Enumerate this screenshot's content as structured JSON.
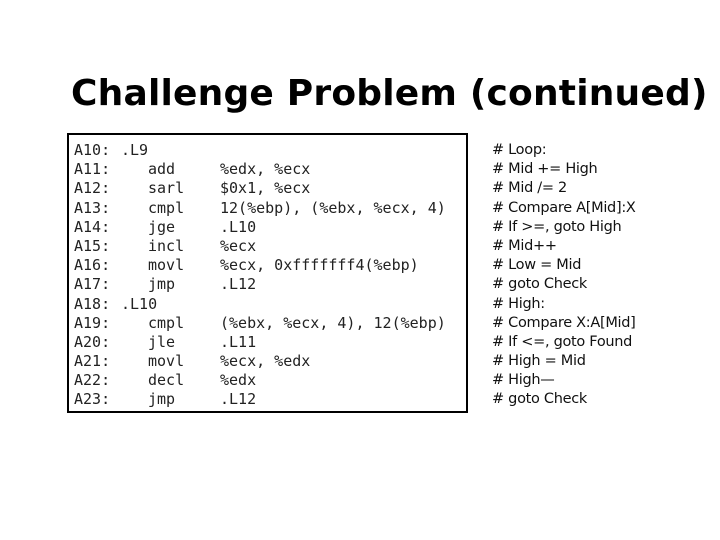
{
  "slide": {
    "title": "Challenge Problem (continued)"
  },
  "code": {
    "lines": [
      {
        "addr": "A10:",
        "label": ".L9",
        "op": "",
        "args": ""
      },
      {
        "addr": "A11:",
        "label": "",
        "op": "add",
        "args": "%edx, %ecx"
      },
      {
        "addr": "A12:",
        "label": "",
        "op": "sarl",
        "args": "$0x1, %ecx"
      },
      {
        "addr": "A13:",
        "label": "",
        "op": "cmpl",
        "args": "12(%ebp), (%ebx, %ecx, 4)"
      },
      {
        "addr": "A14:",
        "label": "",
        "op": "jge",
        "args": ".L10"
      },
      {
        "addr": "A15:",
        "label": "",
        "op": "incl",
        "args": "%ecx"
      },
      {
        "addr": "A16:",
        "label": "",
        "op": "movl",
        "args": "%ecx, 0xfffffff4(%ebp)"
      },
      {
        "addr": "A17:",
        "label": "",
        "op": "jmp",
        "args": ".L12"
      },
      {
        "addr": "A18:",
        "label": ".L10",
        "op": "",
        "args": ""
      },
      {
        "addr": "A19:",
        "label": "",
        "op": "cmpl",
        "args": "(%ebx, %ecx, 4), 12(%ebp)"
      },
      {
        "addr": "A20:",
        "label": "",
        "op": "jle",
        "args": ".L11"
      },
      {
        "addr": "A21:",
        "label": "",
        "op": "movl",
        "args": "%ecx, %edx"
      },
      {
        "addr": "A22:",
        "label": "",
        "op": "decl",
        "args": "%edx"
      },
      {
        "addr": "A23:",
        "label": "",
        "op": "jmp",
        "args": ".L12"
      }
    ]
  },
  "comments": {
    "lines": [
      "# Loop:",
      "# Mid += High",
      "# Mid /= 2",
      "# Compare A[Mid]:X",
      "# If >=, goto High",
      "# Mid++",
      "# Low = Mid",
      "# goto Check",
      "# High:",
      "# Compare X:A[Mid]",
      "# If <=, goto Found",
      "# High = Mid",
      "# High—",
      "# goto Check"
    ]
  }
}
